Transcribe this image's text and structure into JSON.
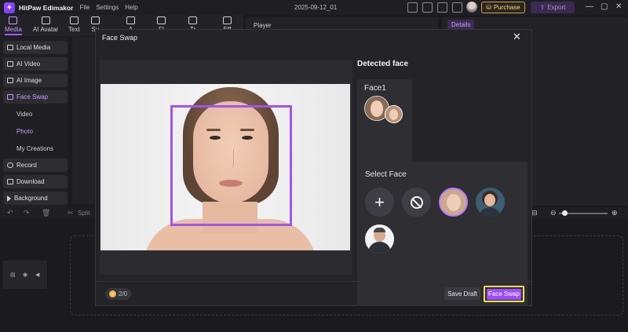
{
  "titlebar": {
    "app_name": "HitPaw Edimakor",
    "menu": [
      "File",
      "Settings",
      "Help"
    ],
    "project_name": "2025-09-12_01",
    "purchase_label": "Purchase",
    "export_label": "Export"
  },
  "toolbar": {
    "tabs": [
      {
        "label": "Media",
        "active": true
      },
      {
        "label": "AI Avatar"
      },
      {
        "label": "Text"
      },
      {
        "label": "Su"
      },
      {
        "label": "A"
      },
      {
        "label": "Fl"
      },
      {
        "label": "Tr"
      },
      {
        "label": "Eff"
      }
    ]
  },
  "player": {
    "label": "Player"
  },
  "details": {
    "label": "Details"
  },
  "sidebar": {
    "items": [
      {
        "label": "Local Media"
      },
      {
        "label": "AI Video"
      },
      {
        "label": "AI Image"
      },
      {
        "label": "Face Swap",
        "active": true
      },
      {
        "label": "Record"
      },
      {
        "label": "Download"
      },
      {
        "label": "Background"
      }
    ],
    "subitems": [
      {
        "label": "Video"
      },
      {
        "label": "Photo",
        "active": true
      },
      {
        "label": "My Creations"
      }
    ]
  },
  "timeline": {
    "split_label": "Split"
  },
  "modal": {
    "title": "Face Swap",
    "detected_title": "Detected face",
    "face_label": "Face1",
    "select_title": "Select Face",
    "credits": "2/0",
    "save_draft": "Save Draft",
    "face_swap_button": "Face Swap",
    "options": [
      {
        "name": "add"
      },
      {
        "name": "none"
      },
      {
        "name": "woman-1",
        "selected": true
      },
      {
        "name": "woman-2"
      },
      {
        "name": "man-1"
      }
    ]
  },
  "colors": {
    "accent": "#a259ff",
    "highlight": "#f2e04a"
  }
}
